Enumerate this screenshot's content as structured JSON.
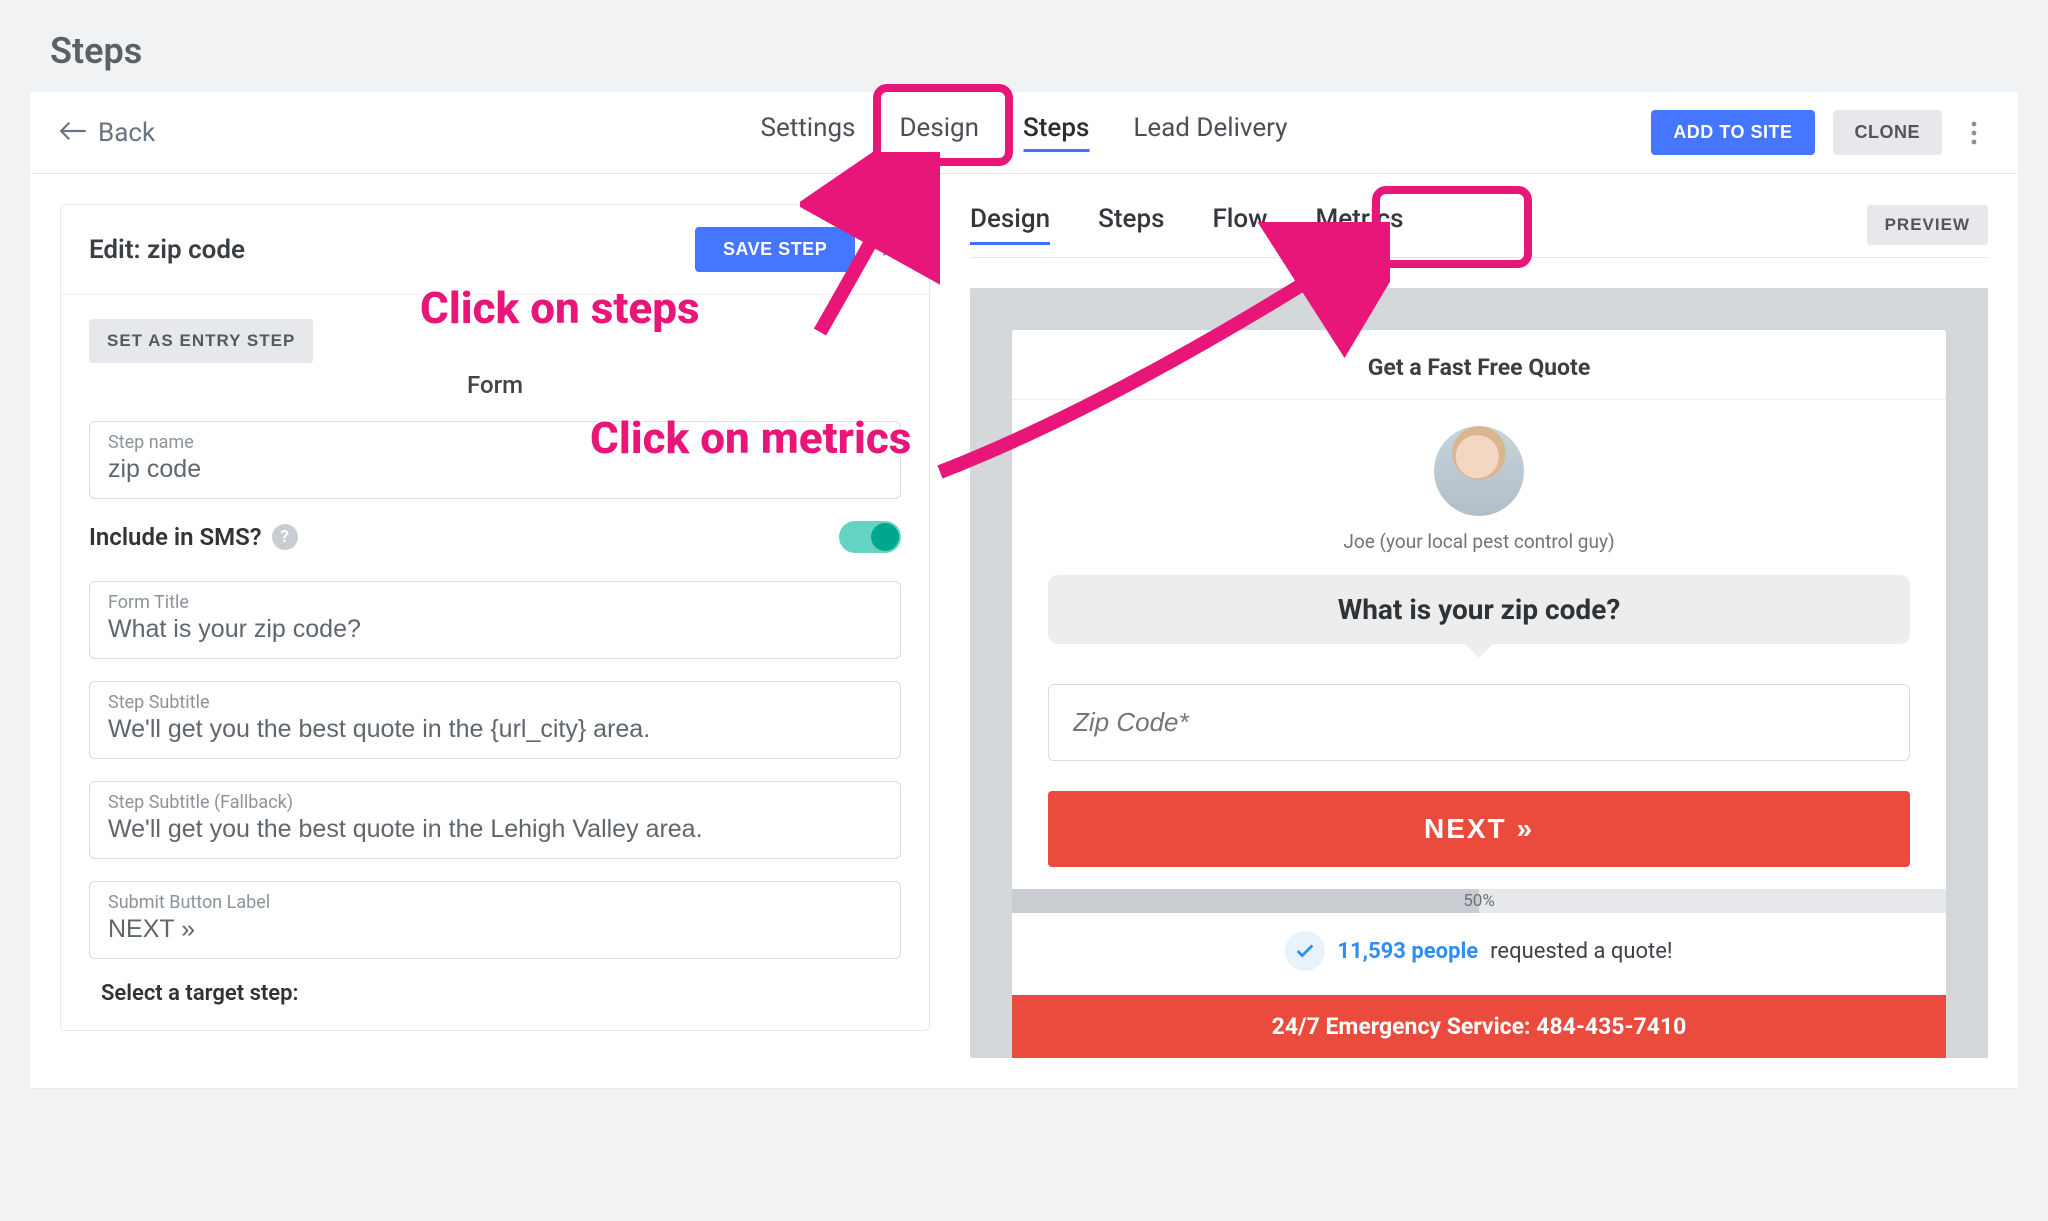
{
  "page": {
    "title": "Steps"
  },
  "topbar": {
    "back": "Back",
    "tabs": {
      "settings": "Settings",
      "design": "Design",
      "steps": "Steps",
      "lead_delivery": "Lead Delivery"
    },
    "add_to_site": "ADD TO SITE",
    "clone": "CLONE"
  },
  "edit": {
    "title": "Edit: zip code",
    "save": "SAVE STEP",
    "entry_btn": "SET AS ENTRY STEP",
    "form_heading": "Form",
    "step_name": {
      "label": "Step name",
      "value": "zip code"
    },
    "sms_label": "Include in SMS?",
    "form_title": {
      "label": "Form Title",
      "value": "What is your zip code?"
    },
    "subtitle": {
      "label": "Step Subtitle",
      "value": "We'll get you the best quote in the {url_city} area."
    },
    "subtitle_fb": {
      "label": "Step Subtitle (Fallback)",
      "value": "We'll get you the best quote in the Lehigh Valley area."
    },
    "submit_label": {
      "label": "Submit Button Label",
      "value": "NEXT »"
    },
    "target_label": "Select a target step:"
  },
  "subtabs": {
    "design": "Design",
    "steps": "Steps",
    "flow": "Flow",
    "metrics": "Metrics"
  },
  "preview_btn": "PREVIEW",
  "widget": {
    "header": "Get a Fast Free Quote",
    "avatar_caption": "Joe (your local pest control guy)",
    "question": "What is your zip code?",
    "zip_placeholder": "Zip Code*",
    "next": "NEXT »",
    "progress_pct": "50%",
    "progress_width": "50%",
    "social_count": "11,593 people",
    "social_rest": "requested a quote!",
    "emergency": "24/7 Emergency Service: 484-435-7410"
  },
  "annotations": {
    "steps_callout": "Click on steps",
    "metrics_callout": "Click on metrics"
  }
}
